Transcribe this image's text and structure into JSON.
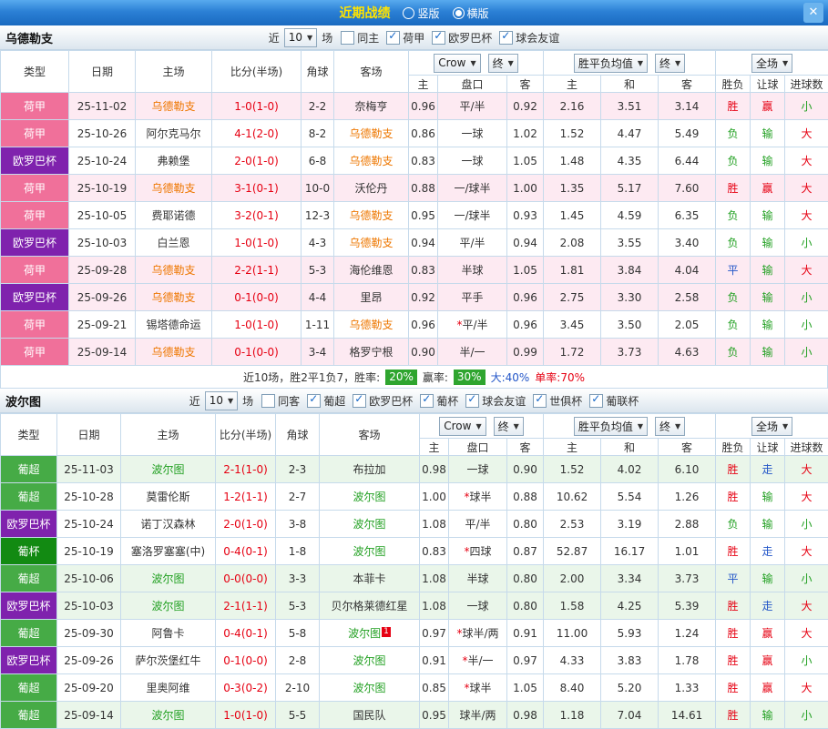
{
  "topbar": {
    "title": "近期战绩",
    "radio_options": [
      {
        "label": "竖版",
        "selected": false
      },
      {
        "label": "横版",
        "selected": true
      }
    ],
    "close_label": "✕"
  },
  "common": {
    "near_label": "近",
    "near_value": "10",
    "games_label": "场",
    "col_headers": [
      "类型",
      "日期",
      "主场",
      "比分(半场)",
      "角球",
      "客场"
    ],
    "odds_headers": [
      "主",
      "盘口",
      "客",
      "主",
      "和",
      "客",
      "胜负",
      "让球",
      "进球数"
    ],
    "bookmaker_dropdown": "Crow",
    "final_dropdown": "终",
    "wdl_dropdown": "胜平负均值",
    "scope_dropdown": "全场"
  },
  "league_colors": {
    "荷甲": "#f0709a",
    "欧罗巴杯": "#7f22ad",
    "葡超": "#46ab46",
    "葡杯": "#128a12"
  },
  "sections": [
    {
      "team": "乌德勒支",
      "team_color": "#ee7700",
      "home_row_bg": "#fdeaf2",
      "filters": [
        {
          "label": "同主",
          "checked": false
        },
        {
          "label": "荷甲",
          "checked": true
        },
        {
          "label": "欧罗巴杯",
          "checked": true
        },
        {
          "label": "球会友谊",
          "checked": true
        }
      ],
      "rows": [
        {
          "league": "荷甲",
          "date": "25-11-02",
          "home": "乌德勒支",
          "score": "1-0(1-0)",
          "corner": "2-2",
          "away": "奈梅亨",
          "odds": [
            "0.96",
            "平/半",
            "0.92",
            "2.16",
            "3.51",
            "3.14"
          ],
          "results": [
            "胜",
            "赢",
            "小"
          ],
          "hl": true
        },
        {
          "league": "荷甲",
          "date": "25-10-26",
          "home": "阿尔克马尔",
          "score": "4-1(2-0)",
          "corner": "8-2",
          "away": "乌德勒支",
          "odds": [
            "0.86",
            "一球",
            "1.02",
            "1.52",
            "4.47",
            "5.49"
          ],
          "results": [
            "负",
            "输",
            "大"
          ],
          "hl": false
        },
        {
          "league": "欧罗巴杯",
          "date": "25-10-24",
          "home": "弗赖堡",
          "score": "2-0(1-0)",
          "corner": "6-8",
          "away": "乌德勒支",
          "odds": [
            "0.83",
            "一球",
            "1.05",
            "1.48",
            "4.35",
            "6.44"
          ],
          "results": [
            "负",
            "输",
            "大"
          ],
          "hl": false
        },
        {
          "league": "荷甲",
          "date": "25-10-19",
          "home": "乌德勒支",
          "score": "3-1(0-1)",
          "corner": "10-0",
          "away": "沃伦丹",
          "odds": [
            "0.88",
            "一/球半",
            "1.00",
            "1.35",
            "5.17",
            "7.60"
          ],
          "results": [
            "胜",
            "赢",
            "大"
          ],
          "hl": true
        },
        {
          "league": "荷甲",
          "date": "25-10-05",
          "home": "费耶诺德",
          "score": "3-2(0-1)",
          "corner": "12-3",
          "away": "乌德勒支",
          "odds": [
            "0.95",
            "一/球半",
            "0.93",
            "1.45",
            "4.59",
            "6.35"
          ],
          "results": [
            "负",
            "输",
            "大"
          ],
          "hl": false
        },
        {
          "league": "欧罗巴杯",
          "date": "25-10-03",
          "home": "白兰恩",
          "score": "1-0(1-0)",
          "corner": "4-3",
          "away": "乌德勒支",
          "odds": [
            "0.94",
            "平/半",
            "0.94",
            "2.08",
            "3.55",
            "3.40"
          ],
          "results": [
            "负",
            "输",
            "小"
          ],
          "hl": false
        },
        {
          "league": "荷甲",
          "date": "25-09-28",
          "home": "乌德勒支",
          "score": "2-2(1-1)",
          "corner": "5-3",
          "away": "海伦维恩",
          "odds": [
            "0.83",
            "半球",
            "1.05",
            "1.81",
            "3.84",
            "4.04"
          ],
          "results": [
            "平",
            "输",
            "大"
          ],
          "hl": true
        },
        {
          "league": "欧罗巴杯",
          "date": "25-09-26",
          "home": "乌德勒支",
          "score": "0-1(0-0)",
          "corner": "4-4",
          "away": "里昂",
          "odds": [
            "0.92",
            "平手",
            "0.96",
            "2.75",
            "3.30",
            "2.58"
          ],
          "results": [
            "负",
            "输",
            "小"
          ],
          "hl": true
        },
        {
          "league": "荷甲",
          "date": "25-09-21",
          "home": "锡塔德命运",
          "score": "1-0(1-0)",
          "corner": "1-11",
          "away": "乌德勒支",
          "odds": [
            "0.96",
            "*平/半",
            "0.96",
            "3.45",
            "3.50",
            "2.05"
          ],
          "results": [
            "负",
            "输",
            "小"
          ],
          "hl": false
        },
        {
          "league": "荷甲",
          "date": "25-09-14",
          "home": "乌德勒支",
          "score": "0-1(0-0)",
          "corner": "3-4",
          "away": "格罗宁根",
          "odds": [
            "0.90",
            "半/一",
            "0.99",
            "1.72",
            "3.73",
            "4.63"
          ],
          "results": [
            "负",
            "输",
            "小"
          ],
          "hl": true
        }
      ],
      "footer": {
        "summary": "近10场，胜2平1负7，胜率:",
        "win_rate": "20%",
        "odds_win_label": "赢率:",
        "odds_win_rate": "30%",
        "big_rate": "大:40%",
        "single_rate": "单率:70%"
      }
    },
    {
      "team": "波尔图",
      "team_color": "#22a022",
      "home_row_bg": "#eaf6ea",
      "filters": [
        {
          "label": "同客",
          "checked": false
        },
        {
          "label": "葡超",
          "checked": true
        },
        {
          "label": "欧罗巴杯",
          "checked": true
        },
        {
          "label": "葡杯",
          "checked": true
        },
        {
          "label": "球会友谊",
          "checked": true
        },
        {
          "label": "世俱杯",
          "checked": true
        },
        {
          "label": "葡联杯",
          "checked": true
        }
      ],
      "rows": [
        {
          "league": "葡超",
          "date": "25-11-03",
          "home": "波尔图",
          "score": "2-1(1-0)",
          "corner": "2-3",
          "away": "布拉加",
          "odds": [
            "0.98",
            "一球",
            "0.90",
            "1.52",
            "4.02",
            "6.10"
          ],
          "results": [
            "胜",
            "走",
            "大"
          ],
          "hl": true
        },
        {
          "league": "葡超",
          "date": "25-10-28",
          "home": "莫雷伦斯",
          "score": "1-2(1-1)",
          "corner": "2-7",
          "away": "波尔图",
          "odds": [
            "1.00",
            "*球半",
            "0.88",
            "10.62",
            "5.54",
            "1.26"
          ],
          "results": [
            "胜",
            "输",
            "大"
          ],
          "hl": false
        },
        {
          "league": "欧罗巴杯",
          "date": "25-10-24",
          "home": "诺丁汉森林",
          "score": "2-0(1-0)",
          "corner": "3-8",
          "away": "波尔图",
          "odds": [
            "1.08",
            "平/半",
            "0.80",
            "2.53",
            "3.19",
            "2.88"
          ],
          "results": [
            "负",
            "输",
            "小"
          ],
          "hl": false
        },
        {
          "league": "葡杯",
          "date": "25-10-19",
          "home": "塞洛罗塞塞(中)",
          "score": "0-4(0-1)",
          "corner": "1-8",
          "away": "波尔图",
          "odds": [
            "0.83",
            "*四球",
            "0.87",
            "52.87",
            "16.17",
            "1.01"
          ],
          "results": [
            "胜",
            "走",
            "大"
          ],
          "hl": false
        },
        {
          "league": "葡超",
          "date": "25-10-06",
          "home": "波尔图",
          "score": "0-0(0-0)",
          "corner": "3-3",
          "away": "本菲卡",
          "odds": [
            "1.08",
            "半球",
            "0.80",
            "2.00",
            "3.34",
            "3.73"
          ],
          "results": [
            "平",
            "输",
            "小"
          ],
          "hl": true
        },
        {
          "league": "欧罗巴杯",
          "date": "25-10-03",
          "home": "波尔图",
          "score": "2-1(1-1)",
          "corner": "5-3",
          "away": "贝尔格莱德红星",
          "odds": [
            "1.08",
            "一球",
            "0.80",
            "1.58",
            "4.25",
            "5.39"
          ],
          "results": [
            "胜",
            "走",
            "大"
          ],
          "hl": true
        },
        {
          "league": "葡超",
          "date": "25-09-30",
          "home": "阿鲁卡",
          "score": "0-4(0-1)",
          "corner": "5-8",
          "away": "波尔图",
          "away_red_card": "1",
          "odds": [
            "0.97",
            "*球半/两",
            "0.91",
            "11.00",
            "5.93",
            "1.24"
          ],
          "results": [
            "胜",
            "赢",
            "大"
          ],
          "hl": false
        },
        {
          "league": "欧罗巴杯",
          "date": "25-09-26",
          "home": "萨尔茨堡红牛",
          "score": "0-1(0-0)",
          "corner": "2-8",
          "away": "波尔图",
          "odds": [
            "0.91",
            "*半/一",
            "0.97",
            "4.33",
            "3.83",
            "1.78"
          ],
          "results": [
            "胜",
            "赢",
            "小"
          ],
          "hl": false
        },
        {
          "league": "葡超",
          "date": "25-09-20",
          "home": "里奥阿维",
          "score": "0-3(0-2)",
          "corner": "2-10",
          "away": "波尔图",
          "odds": [
            "0.85",
            "*球半",
            "1.05",
            "8.40",
            "5.20",
            "1.33"
          ],
          "results": [
            "胜",
            "赢",
            "大"
          ],
          "hl": false
        },
        {
          "league": "葡超",
          "date": "25-09-14",
          "home": "波尔图",
          "score": "1-0(1-0)",
          "corner": "5-5",
          "away": "国民队",
          "odds": [
            "0.95",
            "球半/两",
            "0.98",
            "1.18",
            "7.04",
            "14.61"
          ],
          "results": [
            "胜",
            "输",
            "小"
          ],
          "hl": true
        }
      ]
    }
  ]
}
